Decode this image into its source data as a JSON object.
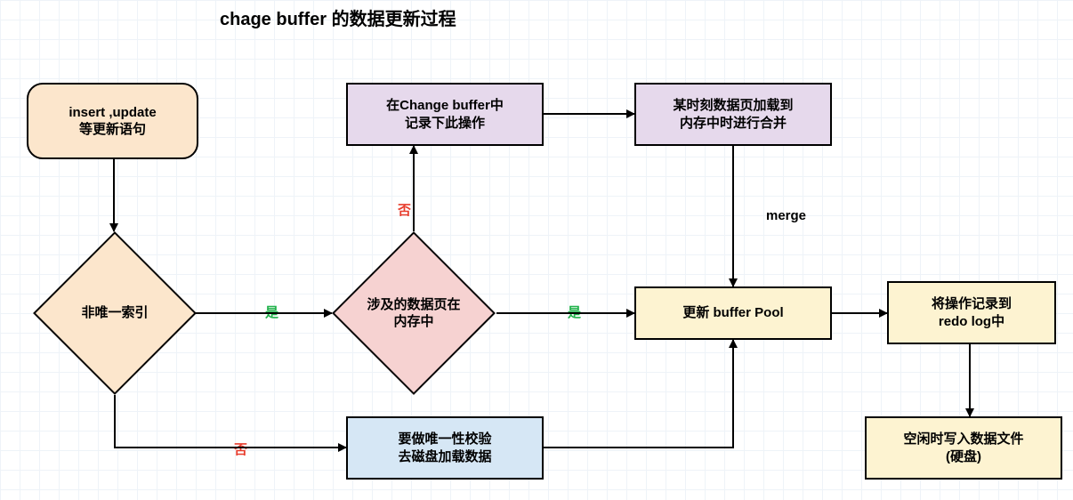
{
  "title": "chage buffer 的数据更新过程",
  "nodes": {
    "start": "insert ,update\n等更新语句",
    "nonUniqueIdx": "非唯一索引",
    "pageInMem": "涉及的数据页在\n内存中",
    "recordInCB": "在Change buffer中\n记录下此操作",
    "mergeLater": "某时刻数据页加载到\n内存中时进行合并",
    "uniqueCheck": "要做唯一性校验\n去磁盘加载数据",
    "updateBP": "更新 buffer Pool",
    "toRedo": "将操作记录到\nredo log中",
    "idleFlush": "空闲时写入数据文件\n(硬盘)"
  },
  "edges": {
    "yes1": "是",
    "yes2": "是",
    "no1": "否",
    "no2": "否",
    "merge": "merge"
  }
}
